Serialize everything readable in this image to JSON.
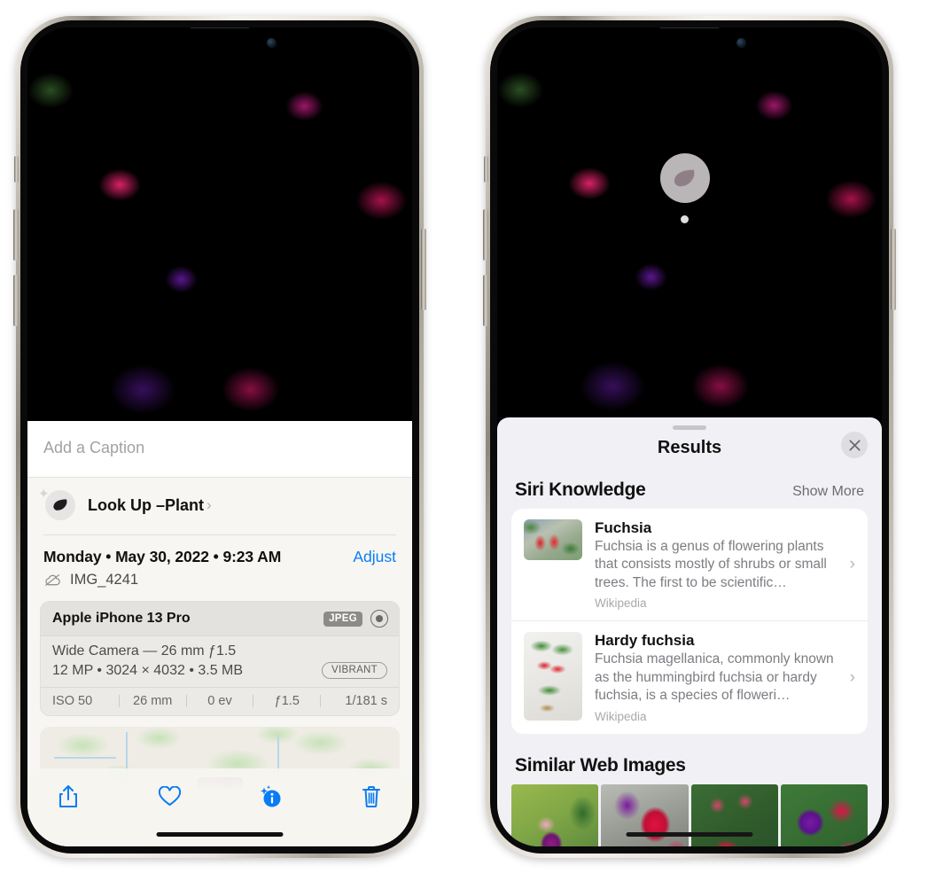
{
  "left_phone": {
    "caption": {
      "placeholder": "Add a Caption",
      "value": ""
    },
    "lookup": {
      "label": "Look Up – ",
      "subject": "Plant",
      "chevron": "›",
      "icon": "leaf-icon",
      "sparkle": "✦"
    },
    "datetime": "Monday • May 30, 2022 • 9:23 AM",
    "adjust_label": "Adjust",
    "filename": "IMG_4241",
    "cloud_icon": "cloud-slash-icon",
    "exif": {
      "device": "Apple iPhone 13 Pro",
      "format_badge": "JPEG",
      "raw_icon": "raw-circle-icon",
      "lens_line": "Wide Camera — 26 mm ƒ1.5",
      "size_line": "12 MP • 3024 × 4032 • 3.5 MB",
      "style_badge": "VIBRANT",
      "stats": [
        "ISO 50",
        "26 mm",
        "0 ev",
        "ƒ1.5",
        "1/181 s"
      ]
    },
    "toolbar": [
      {
        "name": "share-icon",
        "label": "Share"
      },
      {
        "name": "heart-icon",
        "label": "Favorite"
      },
      {
        "name": "info-sparkle-icon",
        "label": "Info"
      },
      {
        "name": "trash-icon",
        "label": "Delete"
      }
    ]
  },
  "right_phone": {
    "vlu_badge": {
      "icon": "leaf-icon"
    },
    "results_title": "Results",
    "close_label": "✕",
    "sections": [
      {
        "title": "Siri Knowledge",
        "action": "Show More",
        "cards": [
          {
            "title": "Fuchsia",
            "desc": "Fuchsia is a genus of flowering plants that consists mostly of shrubs or small trees. The first to be scientific…",
            "source": "Wikipedia",
            "chevron": "›"
          },
          {
            "title": "Hardy fuchsia",
            "desc": "Fuchsia magellanica, commonly known as the hummingbird fuchsia or hardy fuchsia, is a species of floweri…",
            "source": "Wikipedia",
            "chevron": "›"
          }
        ]
      },
      {
        "title": "Similar Web Images",
        "action": "",
        "thumbnails": [
          "fuchsia-web-1",
          "fuchsia-web-2",
          "fuchsia-web-3",
          "fuchsia-web-4"
        ]
      }
    ]
  },
  "colors": {
    "accent_blue": "#0a7cf5",
    "sheet_bg_left": "#f7f6f2",
    "sheet_bg_right": "#f1f0f4",
    "card_bg": "#ffffff",
    "text_primary": "#111111",
    "text_secondary": "#7d7c82"
  }
}
